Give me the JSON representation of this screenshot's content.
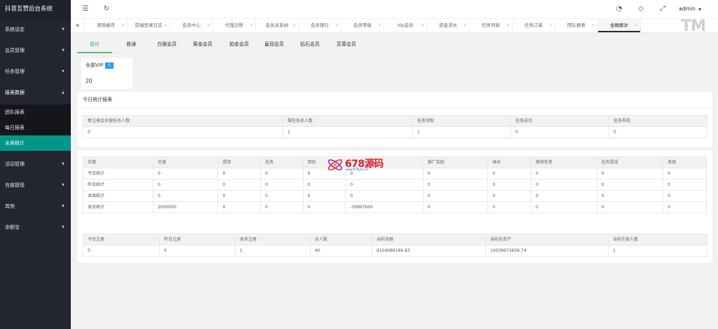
{
  "app": {
    "title": "抖音互赞后台系统"
  },
  "sidebar": {
    "items": [
      {
        "label": "系统设定"
      },
      {
        "label": "会员管理"
      },
      {
        "label": "任务管理"
      },
      {
        "label": "报表数据"
      },
      {
        "label": "活动管理"
      },
      {
        "label": "充值提现"
      },
      {
        "label": "其他"
      },
      {
        "label": "余额宝"
      }
    ],
    "subitems": [
      {
        "label": "团队报表"
      },
      {
        "label": "每日报表"
      },
      {
        "label": "全局统计"
      }
    ]
  },
  "header": {
    "icons": [
      "menu-fold-icon",
      "refresh-icon",
      "theme-icon",
      "tag-icon",
      "fullscreen-icon"
    ],
    "user": "admin"
  },
  "tabs": {
    "items": [
      {
        "label": "清除缓存"
      },
      {
        "label": "前端登录日志"
      },
      {
        "label": "会员中心"
      },
      {
        "label": "代理迁移"
      },
      {
        "label": "会员关系树"
      },
      {
        "label": "会员银行"
      },
      {
        "label": "会员等级"
      },
      {
        "label": "Vip会员"
      },
      {
        "label": "资金流水"
      },
      {
        "label": "任务列表"
      },
      {
        "label": "任务订单"
      },
      {
        "label": "团队报表"
      },
      {
        "label": "全局统计"
      }
    ],
    "close_glyph": "×",
    "watermark": "TM"
  },
  "content_tabs": {
    "items": [
      {
        "label": "总计"
      },
      {
        "label": "普通"
      },
      {
        "label": "白银会员"
      },
      {
        "label": "黄金会员"
      },
      {
        "label": "铂金会员"
      },
      {
        "label": "皇冠会员"
      },
      {
        "label": "钻石会员"
      },
      {
        "label": "至尊会员"
      }
    ]
  },
  "vip_card": {
    "title": "全部VIP",
    "badge": "人",
    "value": "20"
  },
  "today_panel": {
    "title": "今日统计报表",
    "headers": [
      "新注册会员做任务人数",
      "做任务总人数",
      "任务领取",
      "任务成功",
      "任务失败"
    ],
    "values": [
      "0",
      "1",
      "1",
      "0",
      "0"
    ]
  },
  "stats_table": {
    "headers": [
      "日期",
      "充值",
      "提现",
      "任务",
      "回扣",
      "",
      "推广奖励",
      "抽水",
      "撤销任务",
      "任务提成",
      "其他"
    ],
    "rows": [
      [
        "今日统计",
        "0",
        "0",
        "0",
        "0",
        "0",
        "0",
        "0",
        "0",
        "0",
        "0"
      ],
      [
        "昨日统计",
        "0",
        "0",
        "0",
        "0",
        "0",
        "0",
        "0",
        "0",
        "0",
        "0"
      ],
      [
        "本周统计",
        "0",
        "0",
        "0",
        "0",
        "0",
        "0",
        "0",
        "0",
        "0",
        "0"
      ],
      [
        "本月统计",
        "2000000",
        "0",
        "0",
        "0",
        "-59997600",
        "0",
        "0",
        "0",
        "0",
        "0"
      ]
    ]
  },
  "summary_table": {
    "headers": [
      "今日注册",
      "昨日注册",
      "本月注册",
      "总人数",
      "当前余额",
      "当前总资产",
      "当前在线人数"
    ],
    "values": [
      "0",
      "0",
      "1",
      "40",
      "9104089186.83",
      "10039673858.74",
      "1"
    ]
  },
  "overlay_logo": {
    "text": "678源码",
    "subtext": "www.678ym.net"
  }
}
